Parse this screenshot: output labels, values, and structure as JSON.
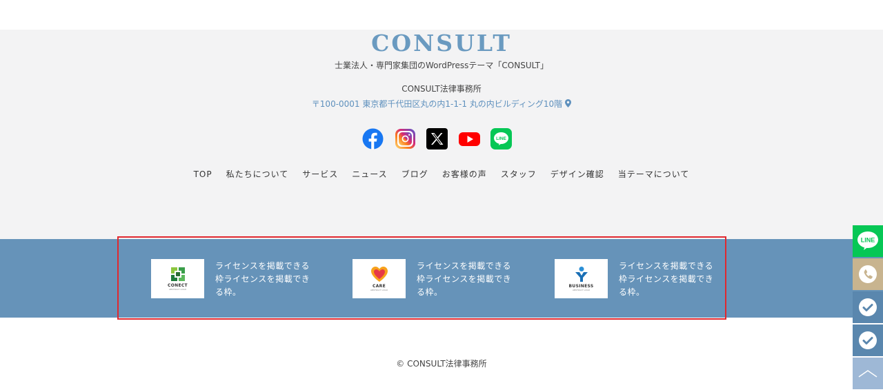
{
  "logo": "CONSULT",
  "tagline": "士業法人・専門家集団のWordPressテーマ「CONSULT」",
  "office_name": "CONSULT法律事務所",
  "address": "〒100-0001 東京都千代田区丸の内1-1-1 丸の内ビルディング10階",
  "social": [
    "facebook-icon",
    "instagram-icon",
    "x-icon",
    "youtube-icon",
    "line-icon"
  ],
  "nav": [
    "TOP",
    "私たちについて",
    "サービス",
    "ニュース",
    "ブログ",
    "お客様の声",
    "スタッフ",
    "デザイン確認",
    "当テーマについて"
  ],
  "licenses": [
    {
      "logo_text": "CONECT",
      "logo_sub": "ABSTRACT LOGO",
      "text": "ライセンスを掲載できる枠ライセンスを掲載できる枠。"
    },
    {
      "logo_text": "CARE",
      "logo_sub": "ABSTRACT LOGO",
      "text": "ライセンスを掲載できる枠ライセンスを掲載できる枠。"
    },
    {
      "logo_text": "BUSINESS",
      "logo_sub": "ABSTRACT LOGO",
      "text": "ライセンスを掲載できる枠ライセンスを掲載できる枠。"
    }
  ],
  "copyright": "© CONSULT法律事務所",
  "side_buttons": [
    {
      "name": "line-icon",
      "label": "LINE",
      "color": "#06c755"
    },
    {
      "name": "phone-icon",
      "color": "#c8b48f"
    },
    {
      "name": "check-icon",
      "color": "#5a87ae"
    },
    {
      "name": "check-icon",
      "color": "#5a87ae"
    },
    {
      "name": "chevron-up-icon",
      "color": "#9eb8d6"
    }
  ],
  "colors": {
    "accent": "#6693b9",
    "logo": "#6a9ac0",
    "highlight": "#e0282e"
  }
}
